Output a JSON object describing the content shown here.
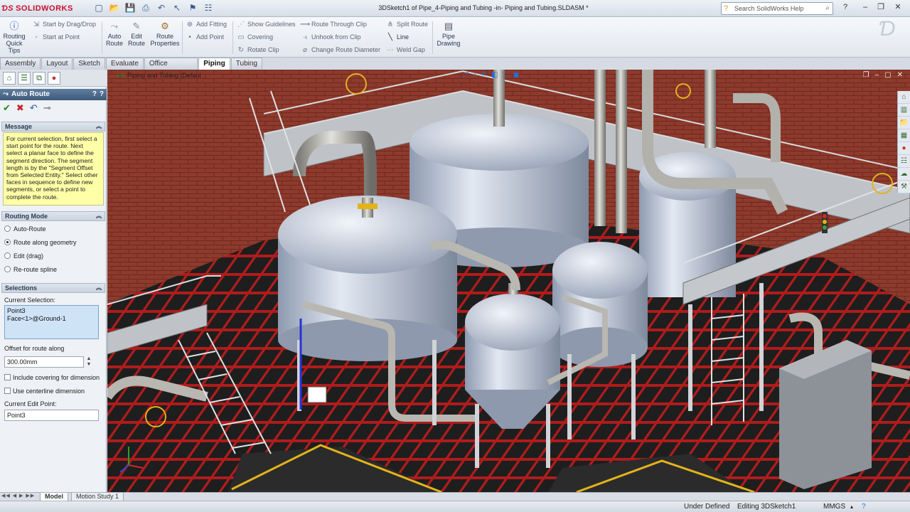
{
  "app": {
    "brand": "SOLIDWORKS",
    "title": "3DSketch1 of Pipe_4-Piping and Tubing -in- Piping and Tubing.SLDASM *"
  },
  "search": {
    "placeholder": "Search SolidWorks Help"
  },
  "ribbon": {
    "quick_tips": "Routing Quick Tips",
    "auto_route": "Auto Route",
    "edit_route": "Edit Route",
    "route_properties": "Route Properties",
    "start_by_drag_drop": "Start by Drag/Drop",
    "start_at_point": "Start at Point",
    "add_fitting": "Add Fitting",
    "add_point": "Add Point",
    "show_guidelines": "Show Guidelines",
    "covering": "Covering",
    "rotate_clip": "Rotate Clip",
    "route_through_clip": "Route Through Clip",
    "unhook_from_clip": "Unhook from Clip",
    "change_route_diameter": "Change Route Diameter",
    "split_route": "Split Route",
    "line": "Line",
    "weld_gap": "Weld Gap",
    "pipe_drawing": "Pipe Drawing"
  },
  "tabs": [
    "Assembly",
    "Layout",
    "Sketch",
    "Evaluate",
    "Office Products",
    "Piping",
    "Tubing"
  ],
  "property_manager": {
    "title": "Auto Route",
    "message_header": "Message",
    "message": "For current selection, first select a start point for the route. Next select a planar face to define the segment direction. The segment length is by the \"Segment Offset from Selected Entity.\" Select other faces in sequence to define new segments, or select a point to complete the route.",
    "routing_mode_header": "Routing Mode",
    "modes": [
      "Auto-Route",
      "Route along geometry",
      "Edit (drag)",
      "Re-route spline"
    ],
    "selected_mode": "Route along geometry",
    "selections_header": "Selections",
    "current_selection_label": "Current Selection:",
    "current_selection": [
      "Point3",
      "Face<1>@Ground-1"
    ],
    "offset_label": "Offset for route along",
    "offset_value": "300.00mm",
    "include_covering": "Include covering for dimension",
    "use_centerline": "Use centerline dimension",
    "current_edit_point_label": "Current Edit Point:",
    "current_edit_point": "Point3"
  },
  "viewport": {
    "tree_label": "Piping and Tubing  (Defaul"
  },
  "bottom_tabs": [
    "Model",
    "Motion Study 1"
  ],
  "status": {
    "state": "Under Defined",
    "editing": "Editing 3DSketch1",
    "units": "MMGS"
  },
  "colors": {
    "brand_red": "#c8102e",
    "pm_header": "#3e5a7b",
    "message_bg": "#ffffa8",
    "floor_red": "#b01c1c",
    "floor_dark": "#2a2a2a",
    "vessel": "#c9d3e3",
    "brick": "#8e3a2c"
  }
}
